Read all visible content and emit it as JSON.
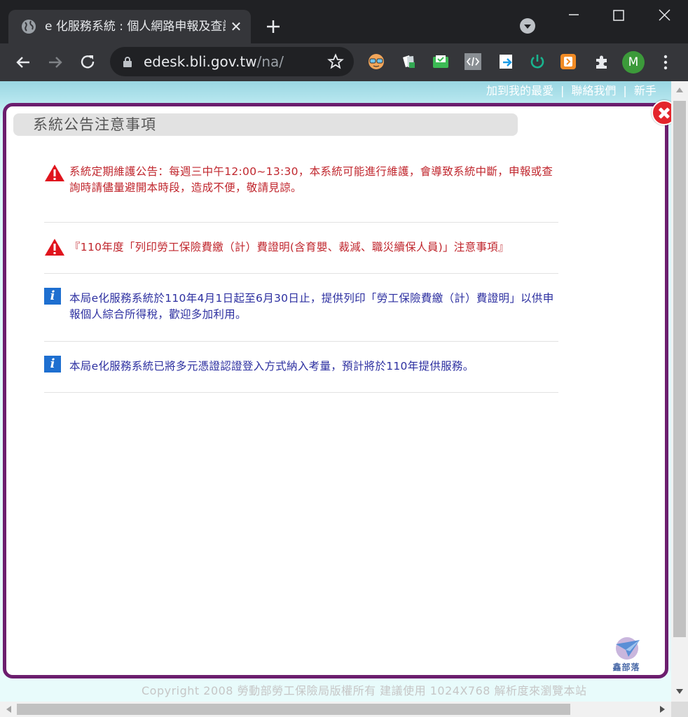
{
  "browser": {
    "tab_title": "e 化服務系統 : 個人網路申報及查詢作業",
    "tab_close": "✕",
    "url_host": "edesk.bli.gov.tw",
    "url_path": "/na/",
    "avatar_letter": "M"
  },
  "page": {
    "top_links": [
      "加到我的最愛",
      "聯絡我們",
      "新手"
    ],
    "footer": "Copyright 2008 勞動部勞工保險局版權所有 建議使用 1024X768 解析度來瀏覽本站"
  },
  "modal": {
    "title": "系統公告注意事項",
    "notices": [
      {
        "type": "warning",
        "text": "系統定期維護公告：每週三中午12:00~13:30，本系統可能進行維護，會導致系統中斷，申報或查詢時請儘量避開本時段，造成不便，敬請見諒。"
      },
      {
        "type": "warning",
        "text": "『110年度「列印勞工保險費繳（計）費證明(含育嬰、裁減、職災續保人員)」注意事項』"
      },
      {
        "type": "info",
        "text": "本局e化服務系統於110年4月1日起至6月30日止，提供列印「勞工保險費繳（計）費證明」以供申報個人綜合所得稅，歡迎多加利用。"
      },
      {
        "type": "info",
        "text": "本局e化服務系統已將多元憑證認證登入方式納入考量，預計將於110年提供服務。"
      }
    ],
    "watermark_text": "鑫部落"
  },
  "colors": {
    "modal_border": "#6c1e6e",
    "warning_text": "#c0262d",
    "info_text": "#2c2fa0",
    "close_button": "#e4252c"
  }
}
